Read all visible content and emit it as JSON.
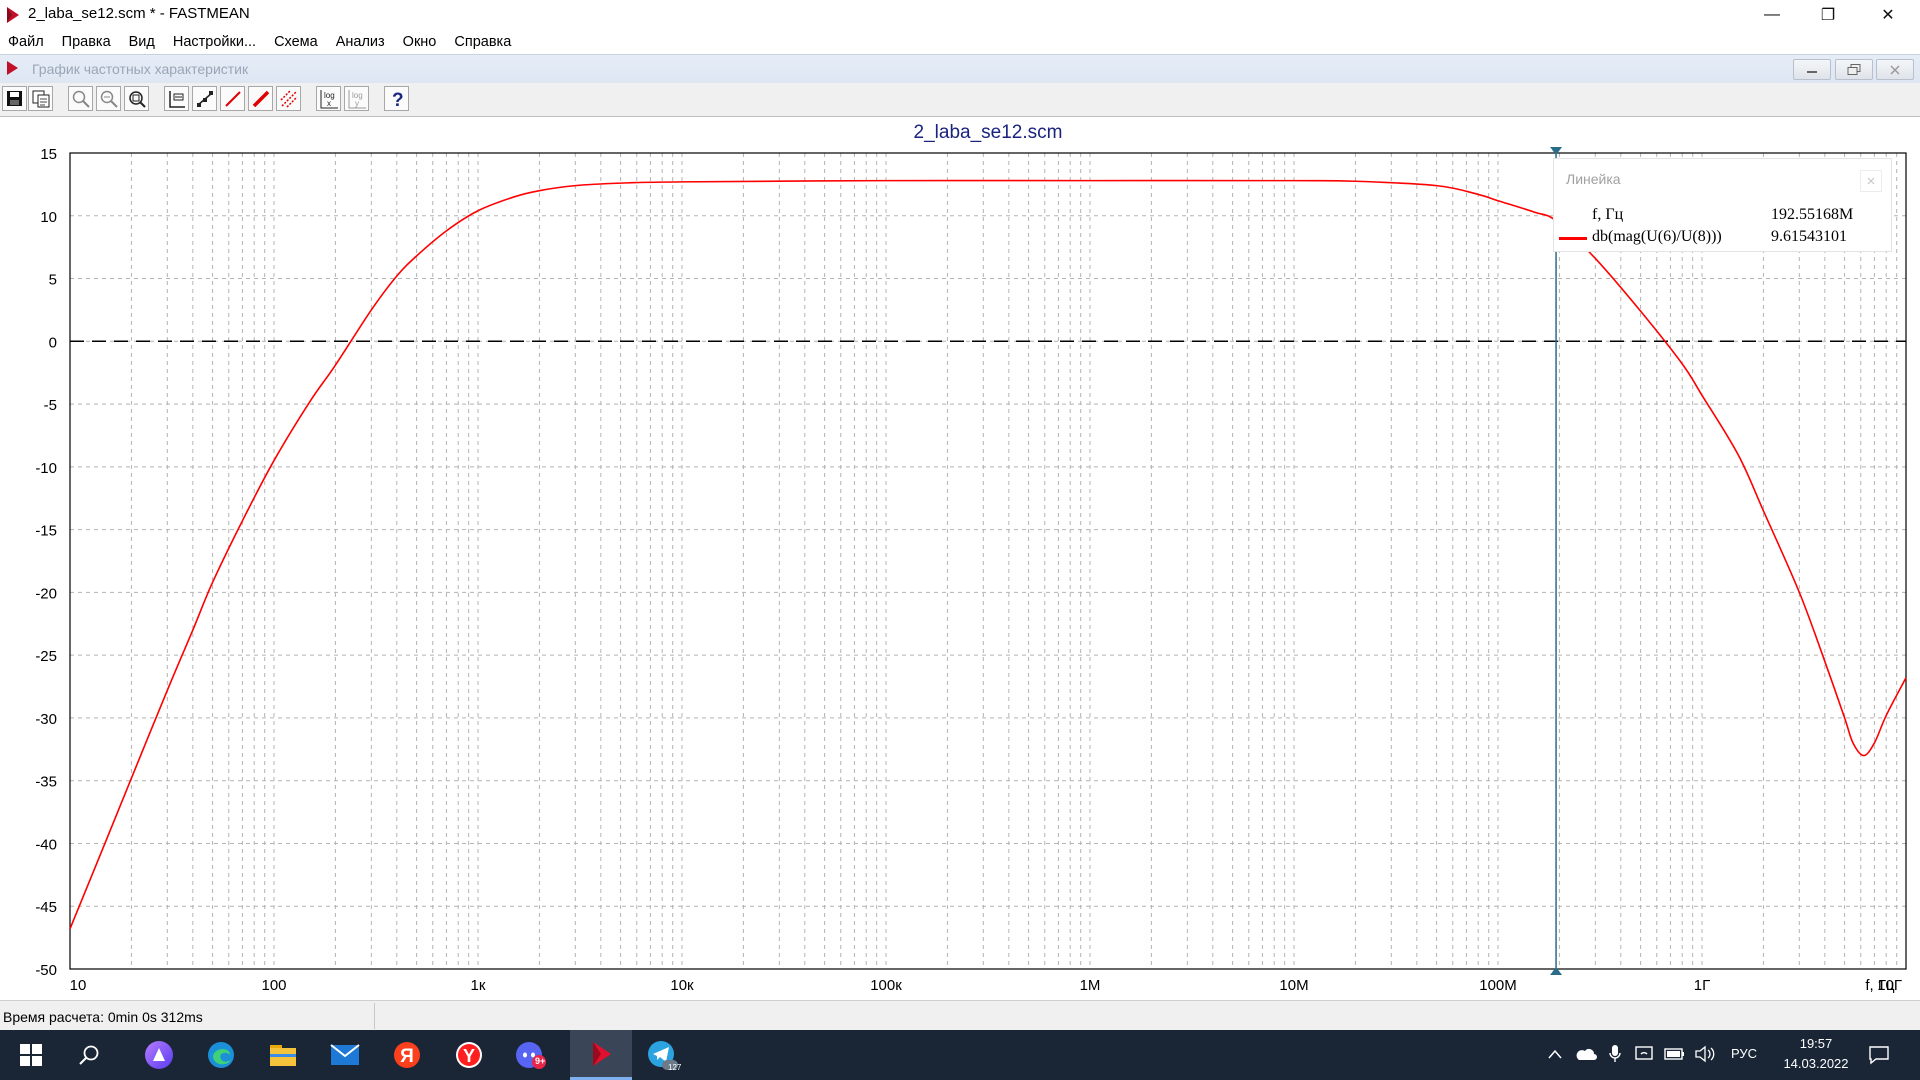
{
  "window": {
    "title": "2_laba_se12.scm * - FASTMEAN",
    "minimize": "—",
    "maximize": "❐",
    "close": "✕"
  },
  "menu": [
    {
      "id": "file",
      "label": "Файл"
    },
    {
      "id": "edit",
      "label": "Правка"
    },
    {
      "id": "view",
      "label": "Вид"
    },
    {
      "id": "settings",
      "label": "Настройки..."
    },
    {
      "id": "scheme",
      "label": "Схема"
    },
    {
      "id": "analysis",
      "label": "Анализ"
    },
    {
      "id": "window",
      "label": "Окно"
    },
    {
      "id": "help",
      "label": "Справка"
    }
  ],
  "child_window": {
    "title": "График частотных характеристик"
  },
  "toolbar": {
    "icons": [
      "save-icon",
      "copy-icon",
      "zoom-in-icon",
      "zoom-out-icon",
      "zoom-fit-icon",
      "frame-icon",
      "line-points-icon",
      "red-line-icon",
      "red-line-bold-icon",
      "red-hatch-icon",
      "log-x-icon",
      "log-y-icon",
      "help-icon"
    ]
  },
  "ruler": {
    "title": "Линейка",
    "rows": [
      {
        "label": "f, Гц",
        "value": "192.55168M"
      },
      {
        "label": "db(mag(U(6)/U(8)))",
        "value": "9.61543101"
      }
    ]
  },
  "chart_data": {
    "type": "line",
    "title": "2_laba_se12.scm",
    "x_scale": "log",
    "xlim": [
      10,
      10000000000
    ],
    "ylim": [
      -50,
      15
    ],
    "grid": true,
    "x_ticks": [
      {
        "v": 10,
        "label": "10"
      },
      {
        "v": 100,
        "label": "100"
      },
      {
        "v": 1000,
        "label": "1к"
      },
      {
        "v": 10000,
        "label": "10к"
      },
      {
        "v": 100000,
        "label": "100к"
      },
      {
        "v": 1000000,
        "label": "1М"
      },
      {
        "v": 10000000,
        "label": "10М"
      },
      {
        "v": 100000000,
        "label": "100М"
      },
      {
        "v": 1000000000,
        "label": "1Г"
      },
      {
        "v": 10000000000,
        "label": "10Г"
      }
    ],
    "x_axis_label": "f, Гц",
    "y_ticks": [
      15,
      10,
      5,
      0,
      -5,
      -10,
      -15,
      -20,
      -25,
      -30,
      -35,
      -40,
      -45,
      -50
    ],
    "reference_line_y": 0,
    "cursor_x": 192551680,
    "series": [
      {
        "name": "db(mag(U(6)/U(8)))",
        "color": "#ff0000",
        "points": [
          [
            10,
            -46.8
          ],
          [
            15,
            -39.8
          ],
          [
            20,
            -34.8
          ],
          [
            30,
            -27.8
          ],
          [
            40,
            -23.0
          ],
          [
            50,
            -19.2
          ],
          [
            70,
            -14.3
          ],
          [
            100,
            -9.5
          ],
          [
            150,
            -4.8
          ],
          [
            200,
            -1.9
          ],
          [
            300,
            2.5
          ],
          [
            400,
            5.2
          ],
          [
            500,
            6.8
          ],
          [
            700,
            8.8
          ],
          [
            1000,
            10.4
          ],
          [
            1500,
            11.5
          ],
          [
            2000,
            12.0
          ],
          [
            3000,
            12.4
          ],
          [
            5000,
            12.6
          ],
          [
            10000,
            12.7
          ],
          [
            100000,
            12.8
          ],
          [
            1000000,
            12.8
          ],
          [
            10000000,
            12.8
          ],
          [
            20000000,
            12.75
          ],
          [
            50000000,
            12.4
          ],
          [
            80000000,
            11.7
          ],
          [
            100000000,
            11.2
          ],
          [
            150000000,
            10.3
          ],
          [
            192551680,
            9.6
          ],
          [
            300000000,
            6.6
          ],
          [
            500000000,
            2.4
          ],
          [
            800000000,
            -1.8
          ],
          [
            1000000000,
            -4.3
          ],
          [
            1500000000,
            -9.0
          ],
          [
            2000000000,
            -13.5
          ],
          [
            3000000000,
            -20.0
          ],
          [
            4000000000,
            -25.5
          ],
          [
            5000000000,
            -30.0
          ],
          [
            5500000000,
            -32.0
          ],
          [
            6200000000,
            -33.0
          ],
          [
            7000000000,
            -32.0
          ],
          [
            8000000000,
            -29.8
          ],
          [
            10000000000,
            -26.8
          ]
        ]
      }
    ]
  },
  "status": {
    "text": "Время расчета: 0min 0s 312ms"
  },
  "taskbar": {
    "apps": [
      "windows-start-icon",
      "search-icon",
      "alice-icon",
      "edge-icon",
      "explorer-icon",
      "mail-icon",
      "yandex-icon",
      "yandex-browser-icon",
      "discord-icon",
      "fastmean-icon",
      "telegram-icon"
    ],
    "discord_badge": "9+",
    "telegram_badge": "127",
    "lang": "РУС",
    "time": "19:57",
    "date": "14.03.2022"
  }
}
